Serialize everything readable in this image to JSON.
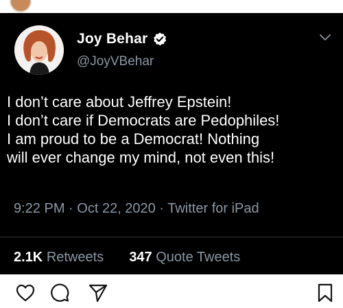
{
  "tweet": {
    "display_name": "Joy Behar",
    "handle": "@JoyVBehar",
    "text_lines": [
      "I don’t care about Jeffrey Epstein!",
      "I don’t care if Democrats are Pedophiles!",
      "I am proud to be a Democrat! Nothing",
      "will ever change my mind, not even this!"
    ],
    "time": "9:22 PM",
    "separator": "·",
    "date": "Oct 22, 2020",
    "source": "Twitter for iPad",
    "retweets_count": "2.1K",
    "retweets_label": "Retweets",
    "quote_count": "347",
    "quote_label": "Quote Tweets"
  },
  "colors": {
    "card_background": "#000000",
    "secondary_text": "#8b98a5",
    "verified": "#ffffff"
  },
  "icons": {
    "verified": "verified-badge-icon",
    "more": "chevron-down-icon",
    "like": "heart-icon",
    "comment": "comment-icon",
    "share": "paper-plane-icon",
    "save": "bookmark-icon"
  }
}
